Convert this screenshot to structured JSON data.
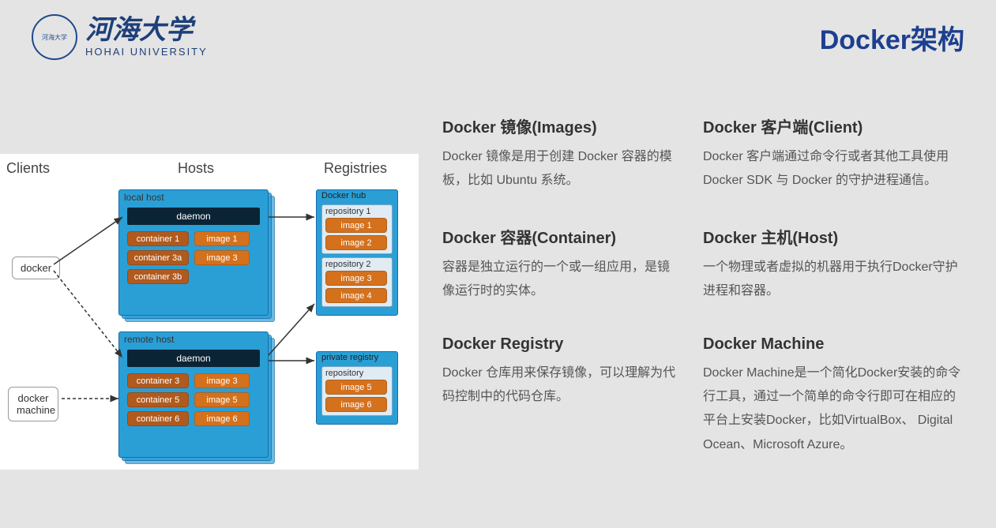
{
  "header": {
    "univ_cn": "河海大学",
    "univ_en": "HOHAI UNIVERSITY",
    "logo_inner": "河海大学",
    "slide_title": "Docker架构"
  },
  "diagram": {
    "col_clients": "Clients",
    "col_hosts": "Hosts",
    "col_registries": "Registries",
    "client_docker": "docker",
    "client_machine": "docker machine",
    "local": {
      "title": "local host",
      "daemon": "daemon",
      "containers": [
        "container 1",
        "container 3a",
        "container 3b"
      ],
      "images": [
        "image 1",
        "image 3"
      ]
    },
    "remote": {
      "title": "remote host",
      "daemon": "daemon",
      "containers": [
        "container 3",
        "container 5",
        "container 6"
      ],
      "images": [
        "image 3",
        "image 5",
        "image 6"
      ]
    },
    "hub": {
      "title": "Docker hub",
      "repos": [
        {
          "name": "repository 1",
          "images": [
            "image 1",
            "image 2"
          ]
        },
        {
          "name": "repository 2",
          "images": [
            "image 3",
            "image 4"
          ]
        }
      ]
    },
    "private": {
      "title": "private registry",
      "repos": [
        {
          "name": "repository",
          "images": [
            "image 5",
            "image 6"
          ]
        }
      ]
    }
  },
  "concepts": {
    "images_h": "Docker 镜像(Images)",
    "images_p": "Docker 镜像是用于创建 Docker 容器的模板，比如 Ubuntu 系统。",
    "client_h": "Docker 客户端(Client)",
    "client_p": "Docker 客户端通过命令行或者其他工具使用 Docker SDK 与 Docker 的守护进程通信。",
    "container_h": "Docker 容器(Container)",
    "container_p": "容器是独立运行的一个或一组应用，是镜像运行时的实体。",
    "host_h": "Docker 主机(Host)",
    "host_p": "一个物理或者虚拟的机器用于执行Docker守护进程和容器。",
    "registry_h": "Docker Registry",
    "registry_p": "Docker 仓库用来保存镜像，可以理解为代码控制中的代码仓库。",
    "machine_h": "Docker Machine",
    "machine_p": "Docker Machine是一个简化Docker安装的命令行工具，通过一个简单的命令行即可在相应的平台上安装Docker，比如VirtualBox、 Digital Ocean、Microsoft Azure。"
  }
}
